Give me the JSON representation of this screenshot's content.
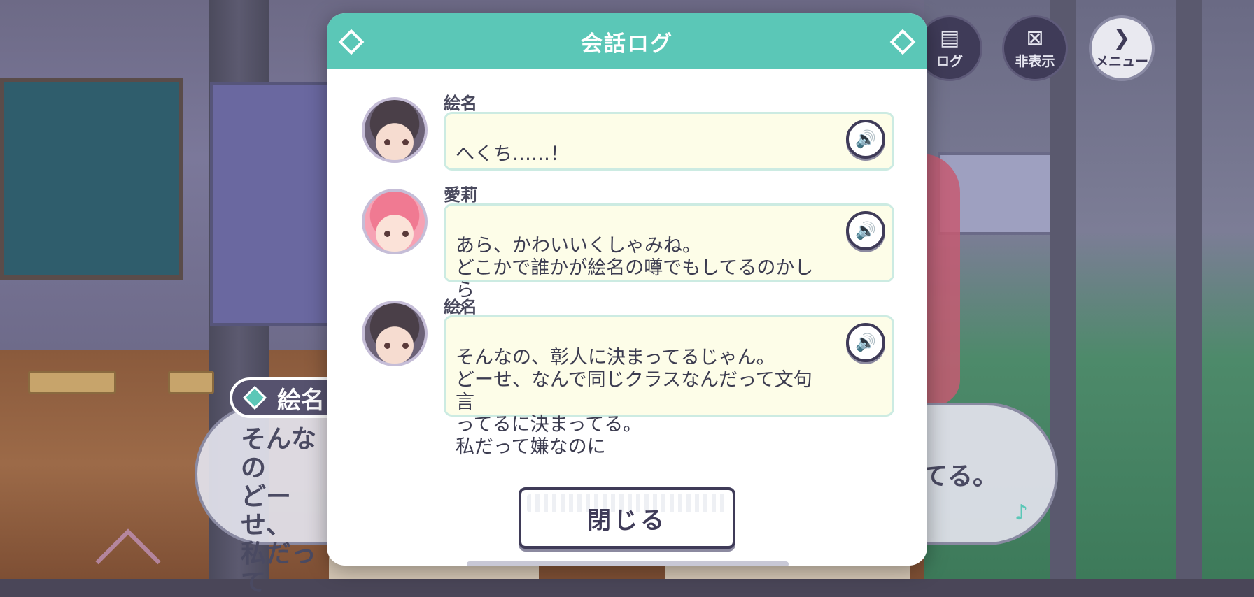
{
  "scene": {
    "dialogue": {
      "speaker": "絵名",
      "text_visible_left": "そんなの\nどーせ、\n私だって",
      "text_visible_right": "てる。"
    }
  },
  "top_buttons": {
    "log_label": "ログ",
    "hide_label": "非表示",
    "menu_label": "メニュー"
  },
  "modal": {
    "title": "会話ログ",
    "entries": [
      {
        "speaker": "絵名",
        "avatar": "ena-avatar",
        "text": "へくち……！"
      },
      {
        "speaker": "愛莉",
        "avatar": "airi-avatar",
        "text": "あら、かわいいくしゃみね。\nどこかで誰かが絵名の噂でもしてるのかしら\n？"
      },
      {
        "speaker": "絵名",
        "avatar": "ena-avatar",
        "text": "そんなの、彰人に決まってるじゃん。\nどーせ、なんで同じクラスなんだって文句言\nってるに決まってる。\n私だって嫌なのに"
      }
    ],
    "close_label": "閉じる"
  },
  "colors": {
    "accent": "#5bc7b7",
    "button_dark": "#3f3b58",
    "bubble_bg": "#fdfde8"
  }
}
